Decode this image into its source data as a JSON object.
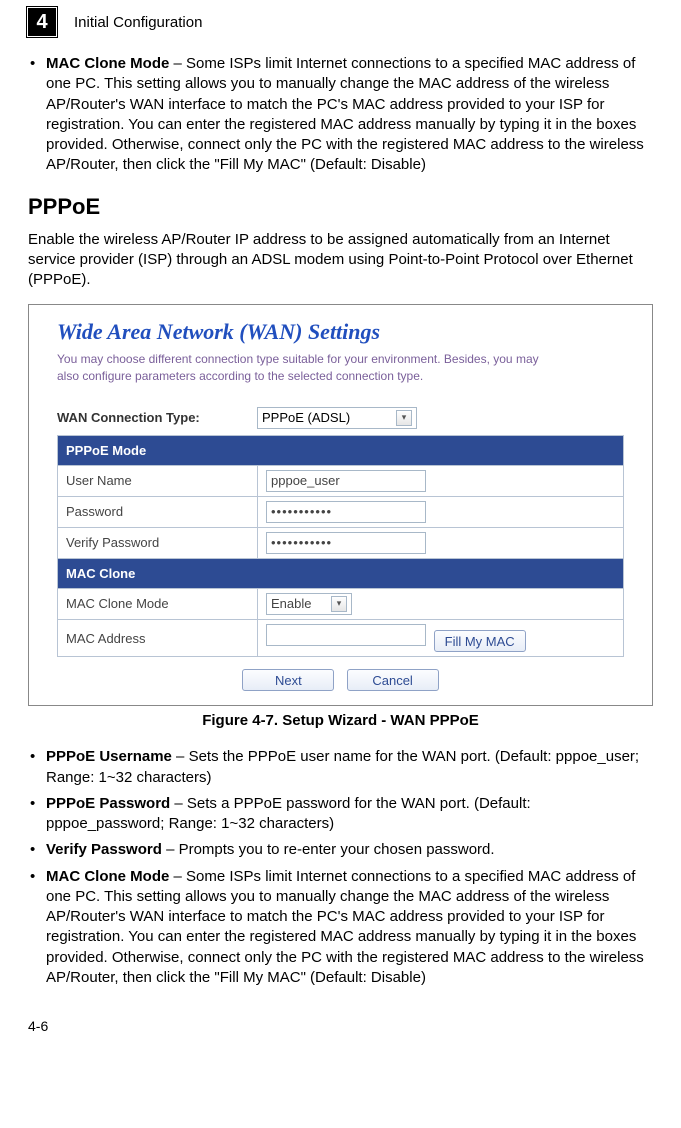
{
  "header": {
    "chapter_number": "4",
    "chapter_title": "Initial Configuration"
  },
  "top_bullets": [
    {
      "term": "MAC Clone Mode",
      "desc": " – Some ISPs limit Internet connections to a specified MAC address of one PC. This setting allows you to manually change the MAC address of the wireless AP/Router's WAN interface to match the PC's MAC address provided to your ISP for registration. You can enter the registered MAC address manually by typing it in the boxes provided. Otherwise, connect only the PC with the registered MAC address to the wireless AP/Router, then click the \"Fill My MAC\" (Default: Disable)"
    }
  ],
  "section_title": "PPPoE",
  "section_intro": "Enable the wireless AP/Router IP address to be assigned automatically from an Internet service provider (ISP) through an ADSL modem using Point-to-Point Protocol over Ethernet (PPPoE).",
  "figure": {
    "panel_title": "Wide Area Network (WAN) Settings",
    "panel_desc": "You may choose different connection type suitable for your environment. Besides, you may also configure parameters according to the selected connection type.",
    "wan_type_label": "WAN Connection Type:",
    "wan_type_value": "PPPoE (ADSL)",
    "pppoe_header": "PPPoE Mode",
    "rows": {
      "username_label": "User Name",
      "username_value": "pppoe_user",
      "password_label": "Password",
      "password_value": "•••••••••••",
      "verify_label": "Verify Password",
      "verify_value": "•••••••••••"
    },
    "mac_header": "MAC Clone",
    "mac_mode_label": "MAC Clone Mode",
    "mac_mode_value": "Enable",
    "mac_addr_label": "MAC Address",
    "mac_addr_value": "",
    "fill_btn": "Fill My MAC",
    "next_btn": "Next",
    "cancel_btn": "Cancel",
    "caption": "Figure 4-7.   Setup Wizard - WAN PPPoE"
  },
  "bottom_bullets": [
    {
      "term": "PPPoE Username",
      "desc": " – Sets the PPPoE user name for the WAN port. (Default: pppoe_user; Range: 1~32 characters)"
    },
    {
      "term": "PPPoE Password",
      "desc": " – Sets a PPPoE password for the WAN port. (Default: pppoe_password; Range: 1~32 characters)"
    },
    {
      "term": "Verify Password",
      "desc": " – Prompts you to re-enter your chosen password."
    },
    {
      "term": "MAC Clone Mode",
      "desc": " – Some ISPs limit Internet connections to a specified MAC address of one PC. This setting allows you to manually change the MAC address of the wireless AP/Router's WAN interface to match the PC's MAC address provided to your ISP for registration. You can enter the registered MAC address manually by typing it in the boxes provided. Otherwise, connect only the PC with the registered MAC address to the wireless AP/Router, then click the \"Fill My MAC\" (Default: Disable)"
    }
  ],
  "page_number": "4-6"
}
